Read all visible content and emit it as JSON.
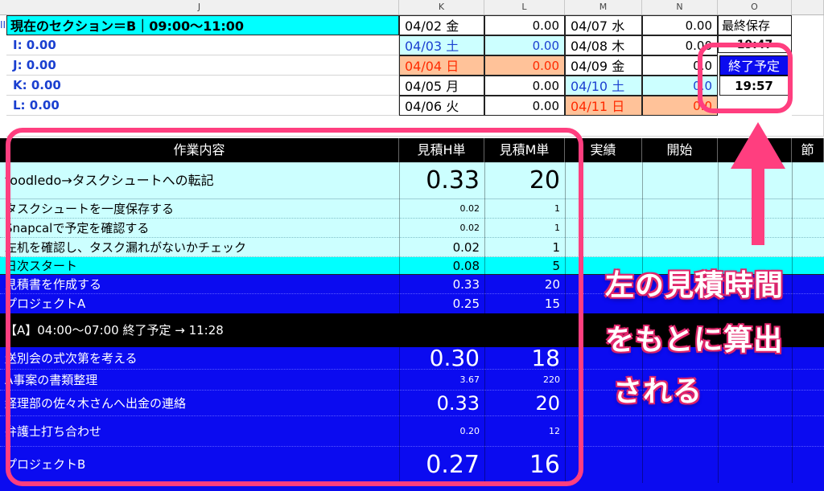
{
  "column_letters": [
    "J",
    "K",
    "L",
    "M",
    "N",
    "O"
  ],
  "section_title": "現在のセクション＝B｜09:00～11:00",
  "left_prefix": "II",
  "summary": [
    "I: 0.00",
    "J: 0.00",
    "K: 0.00",
    "L: 0.00"
  ],
  "calendar": [
    {
      "date": "04/02 金",
      "val": "0.00",
      "date2": "04/07 水",
      "val2": "0.00"
    },
    {
      "date": "04/03 土",
      "val": "0.00",
      "date2": "04/08 木",
      "val2": "0.00"
    },
    {
      "date": "04/04 日",
      "val": "0.00",
      "date2": "04/09 金",
      "val2": "0.0"
    },
    {
      "date": "04/05 月",
      "val": "0.00",
      "date2": "04/10 土",
      "val2": "0.0"
    },
    {
      "date": "04/06 火",
      "val": "0.00",
      "date2": "04/11 日",
      "val2": "0.0"
    }
  ],
  "last_save_label": "最終保存",
  "last_save_value": "19:47",
  "end_plan_label": "終了予定",
  "end_plan_value": "19:57",
  "headers": [
    "作業内容",
    "見積H単",
    "見積M単",
    "実績",
    "開始",
    "終",
    "節"
  ],
  "tasks": [
    {
      "name": "toodledo→タスクシュートへの転記",
      "h": "0.33",
      "m": "20"
    },
    {
      "name": "タスクシュートを一度保存する",
      "h": "0.02",
      "m": "1"
    },
    {
      "name": "Snapcalで予定を確認する",
      "h": "0.02",
      "m": "1"
    },
    {
      "name": "左机を確認し、タスク漏れがないかチェック",
      "h": "0.02",
      "m": "1"
    },
    {
      "name": "日次スタート",
      "h": "0.08",
      "m": "5"
    },
    {
      "name": "見積書を作成する",
      "h": "0.33",
      "m": "20"
    },
    {
      "name": "プロジェクトA",
      "h": "0.25",
      "m": "15"
    },
    {
      "name": "【A】04:00～07:00 終了予定 → 11:28",
      "h": "",
      "m": ""
    },
    {
      "name": "送別会の式次第を考える",
      "h": "0.30",
      "m": "18"
    },
    {
      "name": "A事案の書類整理",
      "h": "3.67",
      "m": "220"
    },
    {
      "name": "経理部の佐々木さんへ出金の連絡",
      "h": "0.33",
      "m": "20"
    },
    {
      "name": "弁護士打ち合わせ",
      "h": "0.20",
      "m": "12"
    },
    {
      "name": "プロジェクトB",
      "h": "0.27",
      "m": "16"
    }
  ],
  "callout": [
    "左の見積時間",
    "をもとに算出",
    "される"
  ],
  "colors": {
    "accent": "#ff3e7f",
    "navy": "#0b0bf0",
    "cyan": "#00ffff",
    "light_cyan": "#ccffff",
    "orange": "#ffc299",
    "header_black": "#000000"
  }
}
